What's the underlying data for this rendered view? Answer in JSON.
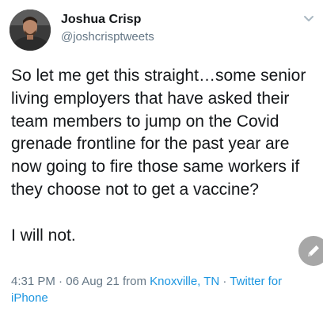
{
  "author": {
    "display_name": "Joshua Crisp",
    "handle": "@joshcrisptweets"
  },
  "tweet": {
    "text": "So let me get this straight…some senior living employers that have asked their team members to jump on the Covid grenade frontline for the past year are now going to fire those same workers if they choose not to get a vaccine?\n\nI will not."
  },
  "meta": {
    "time": "4:31 PM",
    "separator": " · ",
    "date": "06 Aug 21",
    "from_label": " from ",
    "location": "Knoxville, TN",
    "client": "Twitter for iPhone"
  },
  "icons": {
    "menu": "chevron-down-icon",
    "compose": "pencil-icon"
  },
  "colors": {
    "text": "#14171a",
    "secondary": "#657786",
    "link": "#1b95e0",
    "fab": "#a7a7a7"
  }
}
